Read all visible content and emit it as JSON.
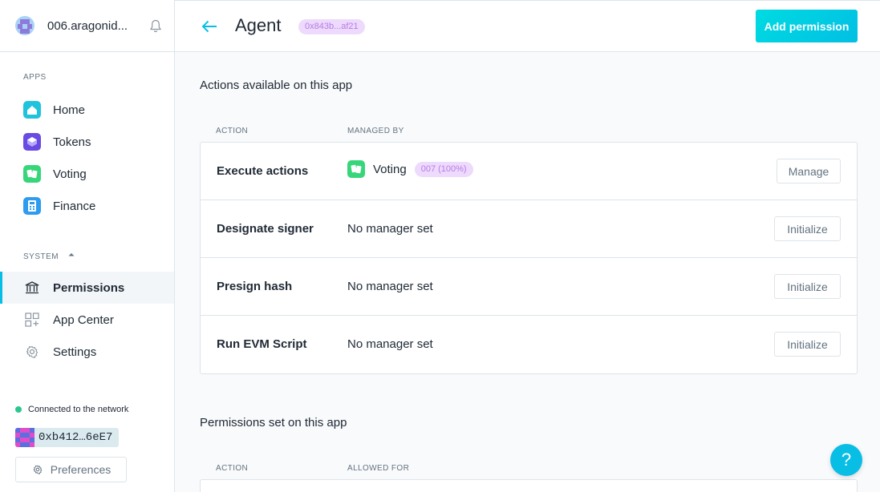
{
  "org": {
    "name": "006.aragonid..."
  },
  "sidebar": {
    "apps_label": "APPS",
    "apps": [
      {
        "label": "Home",
        "icon": "home-icon",
        "color": "#1FC4DC"
      },
      {
        "label": "Tokens",
        "icon": "tokens-icon",
        "color": "#6A4BE2"
      },
      {
        "label": "Voting",
        "icon": "voting-icon",
        "color": "#37D67A"
      },
      {
        "label": "Finance",
        "icon": "finance-icon",
        "color": "#2D9BEF"
      }
    ],
    "system_label": "SYSTEM",
    "system": [
      {
        "label": "Permissions",
        "icon": "bank-icon",
        "active": true
      },
      {
        "label": "App Center",
        "icon": "app-center-icon"
      },
      {
        "label": "Settings",
        "icon": "gear-icon"
      }
    ],
    "status_text": "Connected to the network",
    "account_address": "0xb412…6eE7",
    "preferences_label": "Preferences"
  },
  "topbar": {
    "title": "Agent",
    "address_badge": "0x843b...af21",
    "add_permission_label": "Add permission"
  },
  "actions_section": {
    "title": "Actions available on this app",
    "col_action": "ACTION",
    "col_managed_by": "MANAGED BY",
    "rows": [
      {
        "action": "Execute actions",
        "manager": "Voting",
        "manager_badge": "007 (100%)",
        "button": "Manage"
      },
      {
        "action": "Designate signer",
        "manager": "No manager set",
        "button": "Initialize"
      },
      {
        "action": "Presign hash",
        "manager": "No manager set",
        "button": "Initialize"
      },
      {
        "action": "Run EVM Script",
        "manager": "No manager set",
        "button": "Initialize"
      }
    ]
  },
  "permissions_section": {
    "title": "Permissions set on this app",
    "col_action": "ACTION",
    "col_allowed_for": "ALLOWED FOR"
  },
  "help": {
    "label": "?"
  },
  "colors": {
    "accent": "#08BEE5",
    "badge_bg": "#EEDAFC",
    "badge_text": "#B67CE5",
    "status_green": "#2CC68F"
  }
}
